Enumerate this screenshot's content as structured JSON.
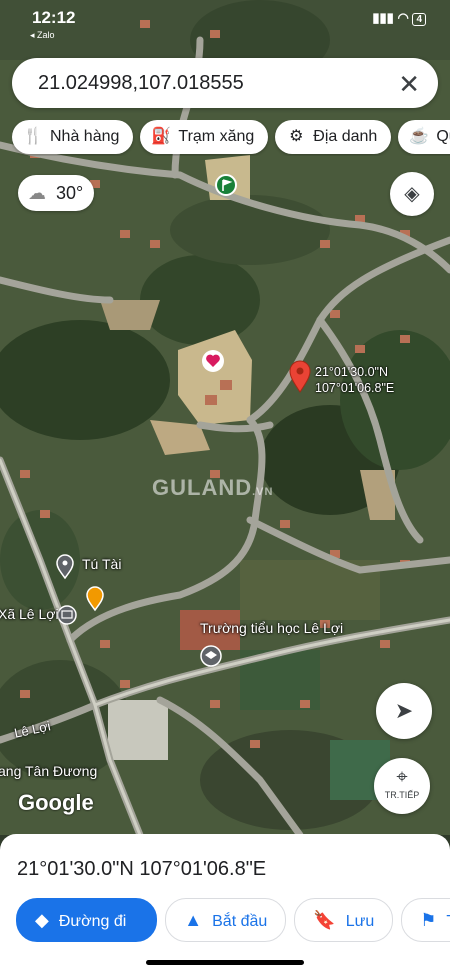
{
  "status_bar": {
    "time": "12:12",
    "back_label": "Zalo",
    "battery": "4"
  },
  "search": {
    "query": "21.024998,107.018555",
    "clear_icon": "close-icon"
  },
  "chips": [
    {
      "label": "Nhà hàng",
      "icon": "restaurant-icon"
    },
    {
      "label": "Trạm xăng",
      "icon": "gas-station-icon"
    },
    {
      "label": "Địa danh",
      "icon": "landmark-icon"
    },
    {
      "label": "Quán",
      "icon": "cafe-icon"
    }
  ],
  "weather": {
    "temp": "30°",
    "icon": "cloud-icon"
  },
  "map": {
    "dropped_pin": {
      "lat_label": "21°01'30.0\"N",
      "lng_label": "107°01'06.8\"E",
      "color": "#ea4335"
    },
    "places": [
      {
        "name": "Tú Tài"
      },
      {
        "name": "Trường tiểu học Lê Lợi"
      },
      {
        "name": "Xã Lê Lợi"
      },
      {
        "name": "Lê Lợi"
      },
      {
        "name": "ang Tân Đương"
      }
    ],
    "watermark": "GULAND",
    "watermark_suffix": ".VN",
    "attribution": "Google"
  },
  "controls": {
    "street_view_label": "TR.TIẾP"
  },
  "sheet": {
    "coordinates": "21°01'30.0\"N 107°01'06.8\"E",
    "actions": [
      {
        "label": "Đường đi",
        "icon": "directions-icon"
      },
      {
        "label": "Bắt đầu",
        "icon": "navigation-arrow-icon"
      },
      {
        "label": "Lưu",
        "icon": "bookmark-icon"
      },
      {
        "label": "Th",
        "icon": "flag-icon"
      }
    ]
  },
  "colors": {
    "accent": "#1a73e8",
    "pin": "#ea4335"
  }
}
